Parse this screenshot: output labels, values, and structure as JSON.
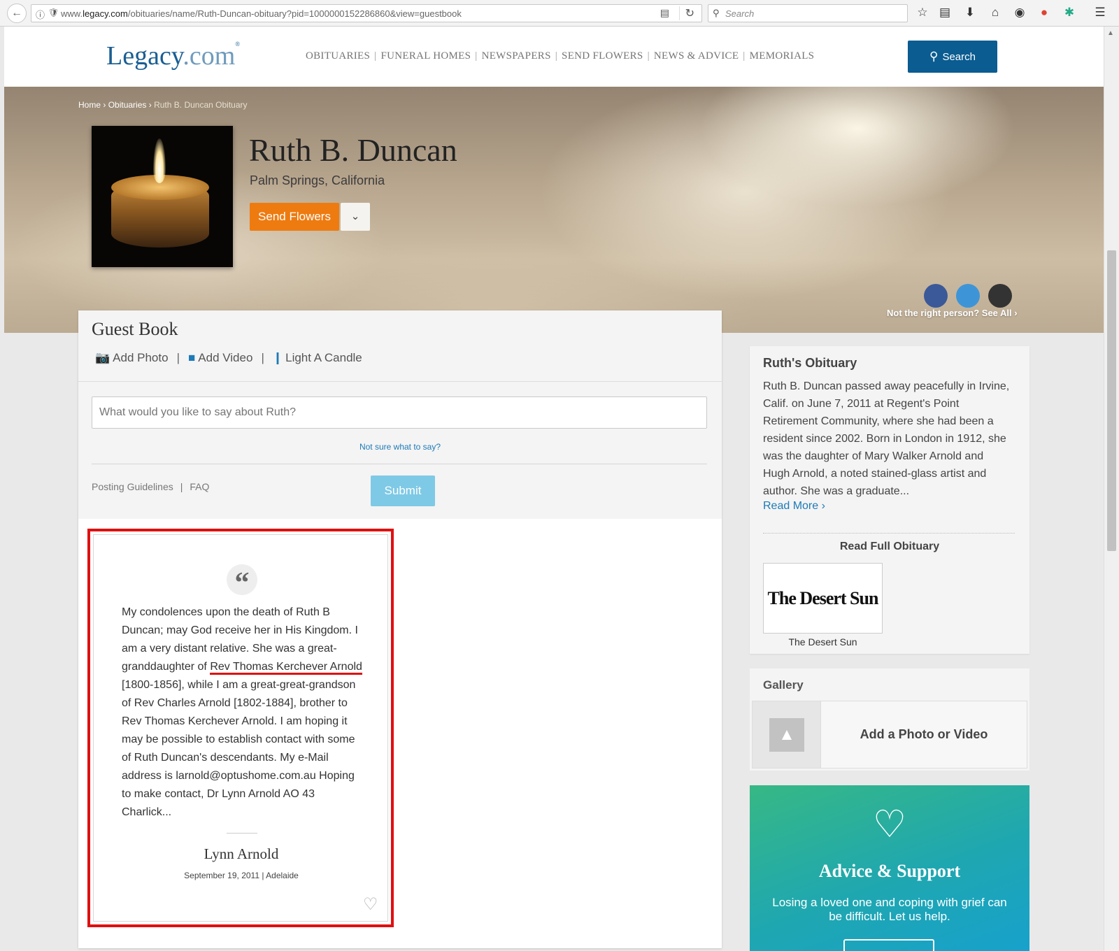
{
  "browser": {
    "url_prefix": "www.",
    "url_domain": "legacy.com",
    "url_path": "/obituaries/name/Ruth-Duncan-obituary?pid=1000000152286860&view=guestbook",
    "search_placeholder": "Search"
  },
  "header": {
    "logo_main": "Legacy",
    "logo_suffix": ".com",
    "logo_mark": "®",
    "nav": [
      "OBITUARIES",
      "FUNERAL HOMES",
      "NEWSPAPERS",
      "SEND FLOWERS",
      "NEWS & ADVICE",
      "MEMORIALS"
    ],
    "nav_separator": "|",
    "search_label": "Search"
  },
  "hero": {
    "breadcrumb": [
      "Home",
      "Obituaries",
      "Ruth B. Duncan Obituary"
    ],
    "breadcrumb_separator": "›",
    "name": "Ruth B. Duncan",
    "location": "Palm Springs, California",
    "send_flowers_label": "Send Flowers",
    "not_right_person": "Not the right person? See All ›",
    "share_colors": [
      "#3b5998",
      "#3d95d8",
      "#333333"
    ]
  },
  "guestbook": {
    "title": "Guest Book",
    "actions": [
      "Add Photo",
      "Add Video",
      "Light A Candle"
    ],
    "separator": "|",
    "input_placeholder": "What would you like to say about Ruth?",
    "not_sure": "Not sure what to say?",
    "links": [
      "Posting Guidelines",
      "FAQ"
    ],
    "submit_label": "Submit",
    "entry": {
      "text_before": "My condolences upon the death of Ruth B Duncan; may God receive her in His Kingdom. I am a very distant relative. She was a great-granddaughter of ",
      "highlight": "Rev Thomas Kerchever Arnold",
      "text_after": " [1800-1856], while I am a great-great-grandson of Rev Charles Arnold [1802-1884], brother to Rev Thomas Kerchever Arnold. I am hoping it may be possible to establish contact with some of Ruth Duncan's descendants. My e-Mail address is larnold@optushome.com.au Hoping to make contact, Dr Lynn Arnold AO 43 Charlick...",
      "author": "Lynn Arnold",
      "date": "September 19, 2011",
      "location": "Adelaide",
      "meta_separator": "|"
    }
  },
  "sidebar": {
    "obituary": {
      "title": "Ruth's Obituary",
      "text": "Ruth B. Duncan passed away peacefully in Irvine, Calif. on June 7, 2011 at Regent's Point Retirement Community, where she had been a resident since 2002. Born in London in 1912, she was the daughter of Mary Walker Arnold and Hugh Arnold, a noted stained-glass artist and author. She was a graduate...",
      "read_more": "Read More ›",
      "read_full": "Read Full Obituary",
      "paper_logo": "The Desert Sun",
      "paper_name": "The Desert Sun"
    },
    "gallery": {
      "title": "Gallery",
      "add_label": "Add a Photo or Video"
    },
    "advice": {
      "title": "Advice & Support",
      "text": "Losing a loved one and coping with grief can be difficult. Let us help."
    }
  },
  "colors": {
    "brand_blue": "#0a5c91",
    "link_blue": "#1d7ab7",
    "flowers_orange": "#ee7b10",
    "submit_light_blue": "#7ec9e6",
    "highlight_red": "#e01010"
  }
}
